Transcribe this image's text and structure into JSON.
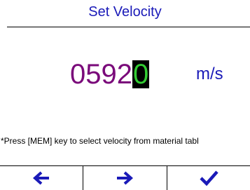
{
  "header": {
    "title": "Set Velocity"
  },
  "velocity": {
    "digits": [
      "0",
      "5",
      "9",
      "2",
      "0"
    ],
    "active_digit_index": 4,
    "unit": "m/s"
  },
  "hint": {
    "text": "*Press [MEM] key to select velocity from material tabl"
  },
  "softkeys": [
    {
      "icon": "arrow-left-icon"
    },
    {
      "icon": "arrow-right-icon"
    },
    {
      "icon": "checkmark-icon"
    }
  ],
  "colors": {
    "title": "#1a1ab8",
    "digits": "#7a0a7a",
    "active_digit_fg": "#33cc33",
    "active_digit_bg": "#000000",
    "unit": "#1a1ab8",
    "softkey_icons": "#1a1ab8"
  }
}
